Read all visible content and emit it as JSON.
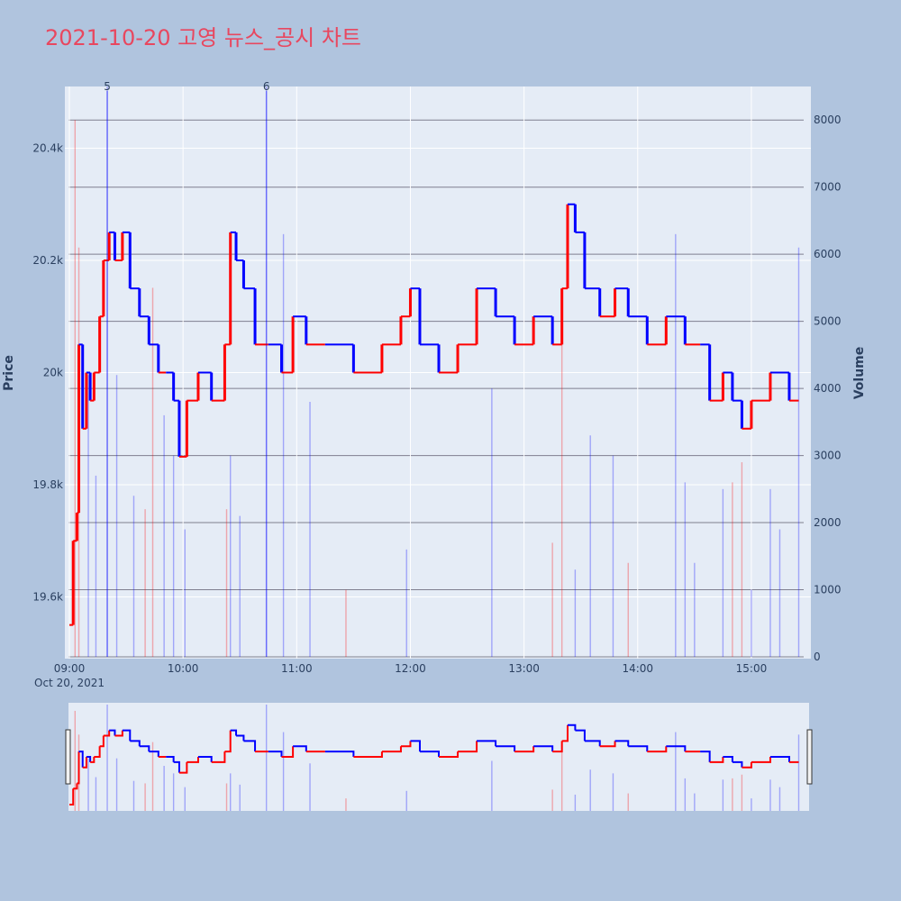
{
  "title": "2021-10-20 고영 뉴스_공시 차트",
  "colors": {
    "title": "#e8475f",
    "up": "#ff0000",
    "down": "#0000ff",
    "plot_bg": "#e5ecf6",
    "page_bg": "#b0c4de"
  },
  "chart_data": {
    "type": "candlestick+bar",
    "date_label": "Oct 20, 2021",
    "x_tick_labels": [
      "09:00",
      "10:00",
      "11:00",
      "12:00",
      "13:00",
      "14:00",
      "15:00"
    ],
    "price_axis": {
      "title": "Price",
      "range": [
        19490,
        20510
      ],
      "tick_labels": [
        "19.6k",
        "19.8k",
        "20k",
        "20.2k",
        "20.4k"
      ],
      "tick_values": [
        19600,
        19800,
        20000,
        20200,
        20400
      ]
    },
    "volume_axis": {
      "title": "Volume",
      "range": [
        0,
        8500
      ],
      "tick_labels": [
        "0",
        "1000",
        "2000",
        "3000",
        "4000",
        "5000",
        "6000",
        "7000",
        "8000"
      ],
      "tick_values": [
        0,
        1000,
        2000,
        3000,
        4000,
        5000,
        6000,
        7000,
        8000
      ]
    },
    "annotations": [
      {
        "label": "5",
        "time": "09:20"
      },
      {
        "label": "6",
        "time": "10:44"
      }
    ],
    "price_path": [
      [
        "09:00",
        19550
      ],
      [
        "09:02",
        19700
      ],
      [
        "09:04",
        19750
      ],
      [
        "09:05",
        20050
      ],
      [
        "09:07",
        19900
      ],
      [
        "09:09",
        20000
      ],
      [
        "09:11",
        19950
      ],
      [
        "09:13",
        20000
      ],
      [
        "09:16",
        20100
      ],
      [
        "09:18",
        20200
      ],
      [
        "09:21",
        20250
      ],
      [
        "09:24",
        20200
      ],
      [
        "09:28",
        20250
      ],
      [
        "09:32",
        20150
      ],
      [
        "09:37",
        20100
      ],
      [
        "09:42",
        20050
      ],
      [
        "09:47",
        20000
      ],
      [
        "09:51",
        20000
      ],
      [
        "09:55",
        19950
      ],
      [
        "09:58",
        19850
      ],
      [
        "10:02",
        19950
      ],
      [
        "10:08",
        20000
      ],
      [
        "10:15",
        19950
      ],
      [
        "10:22",
        20050
      ],
      [
        "10:25",
        20250
      ],
      [
        "10:28",
        20200
      ],
      [
        "10:32",
        20150
      ],
      [
        "10:38",
        20050
      ],
      [
        "10:45",
        20050
      ],
      [
        "10:52",
        20000
      ],
      [
        "10:58",
        20100
      ],
      [
        "11:05",
        20050
      ],
      [
        "11:15",
        20050
      ],
      [
        "11:30",
        20000
      ],
      [
        "11:45",
        20050
      ],
      [
        "11:55",
        20100
      ],
      [
        "12:00",
        20150
      ],
      [
        "12:05",
        20050
      ],
      [
        "12:15",
        20000
      ],
      [
        "12:25",
        20050
      ],
      [
        "12:35",
        20150
      ],
      [
        "12:45",
        20100
      ],
      [
        "12:55",
        20050
      ],
      [
        "13:05",
        20100
      ],
      [
        "13:15",
        20050
      ],
      [
        "13:20",
        20150
      ],
      [
        "13:23",
        20300
      ],
      [
        "13:27",
        20250
      ],
      [
        "13:32",
        20150
      ],
      [
        "13:40",
        20100
      ],
      [
        "13:48",
        20150
      ],
      [
        "13:55",
        20100
      ],
      [
        "14:05",
        20050
      ],
      [
        "14:15",
        20100
      ],
      [
        "14:25",
        20050
      ],
      [
        "14:33",
        20050
      ],
      [
        "14:38",
        19950
      ],
      [
        "14:45",
        20000
      ],
      [
        "14:50",
        19950
      ],
      [
        "14:55",
        19900
      ],
      [
        "15:00",
        19950
      ],
      [
        "15:10",
        20000
      ],
      [
        "15:20",
        19950
      ],
      [
        "15:25",
        19950
      ]
    ],
    "volume_spikes": [
      [
        "09:03",
        8000,
        "up"
      ],
      [
        "09:05",
        6100,
        "up"
      ],
      [
        "09:10",
        4200,
        "down"
      ],
      [
        "09:14",
        2700,
        "down"
      ],
      [
        "09:20",
        8500,
        "down"
      ],
      [
        "09:25",
        4200,
        "down"
      ],
      [
        "09:34",
        2400,
        "down"
      ],
      [
        "09:40",
        2200,
        "up"
      ],
      [
        "09:44",
        5500,
        "up"
      ],
      [
        "09:50",
        3600,
        "down"
      ],
      [
        "09:55",
        3000,
        "down"
      ],
      [
        "10:01",
        1900,
        "down"
      ],
      [
        "10:23",
        2200,
        "up"
      ],
      [
        "10:25",
        3000,
        "down"
      ],
      [
        "10:30",
        2100,
        "down"
      ],
      [
        "10:44",
        8500,
        "down"
      ],
      [
        "10:53",
        6300,
        "down"
      ],
      [
        "11:07",
        3800,
        "down"
      ],
      [
        "11:26",
        1000,
        "up"
      ],
      [
        "11:58",
        1600,
        "down"
      ],
      [
        "12:43",
        4000,
        "down"
      ],
      [
        "13:15",
        1700,
        "up"
      ],
      [
        "13:20",
        4700,
        "up"
      ],
      [
        "13:27",
        1300,
        "down"
      ],
      [
        "13:35",
        3300,
        "down"
      ],
      [
        "13:47",
        3000,
        "down"
      ],
      [
        "13:55",
        1400,
        "up"
      ],
      [
        "14:20",
        6300,
        "down"
      ],
      [
        "14:25",
        2600,
        "down"
      ],
      [
        "14:30",
        1400,
        "down"
      ],
      [
        "14:45",
        2500,
        "down"
      ],
      [
        "14:50",
        2600,
        "up"
      ],
      [
        "14:55",
        2900,
        "up"
      ],
      [
        "15:00",
        1000,
        "down"
      ],
      [
        "15:10",
        2500,
        "down"
      ],
      [
        "15:15",
        1900,
        "down"
      ],
      [
        "15:25",
        6100,
        "down"
      ]
    ],
    "legend": "none",
    "grid": true
  }
}
